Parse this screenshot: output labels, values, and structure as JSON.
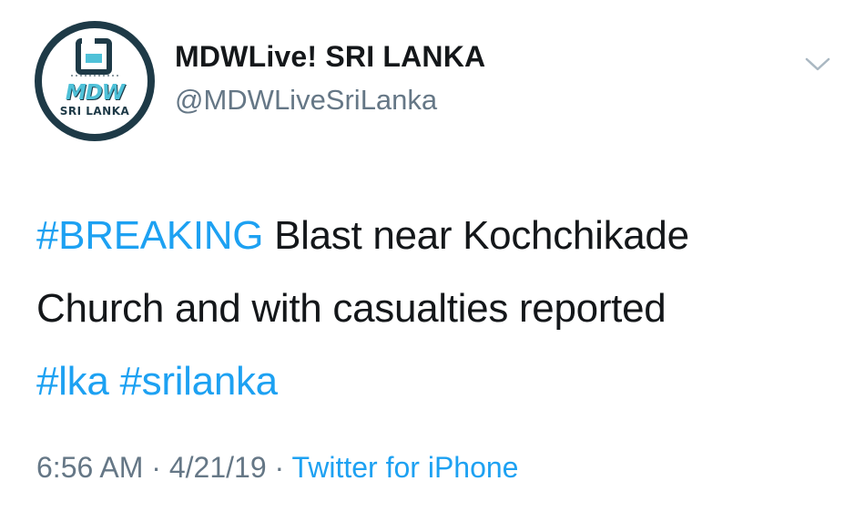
{
  "author": {
    "display_name": "MDWLive! SRI LANKA",
    "handle": "@MDWLiveSriLanka",
    "avatar_logo_text": "MDW",
    "avatar_logo_subtext": "SRI LANKA"
  },
  "tweet": {
    "hashtag_1": "#BREAKING",
    "text_line_1": " Blast near Kochchikade",
    "text_line_2": "Church and with casualties reported",
    "hashtag_2": "#lka",
    "hashtag_3": "#srilanka"
  },
  "meta": {
    "time": "6:56 AM",
    "separator_1": " · ",
    "date": "4/21/19",
    "separator_2": " · ",
    "source": "Twitter for iPhone"
  },
  "icons": {
    "menu": "chevron-down-icon"
  },
  "colors": {
    "hashtag": "#1da1f2",
    "text": "#14171a",
    "secondary": "#657786",
    "avatar_ring": "#1e3a47",
    "logo_accent": "#4fc1d8"
  }
}
